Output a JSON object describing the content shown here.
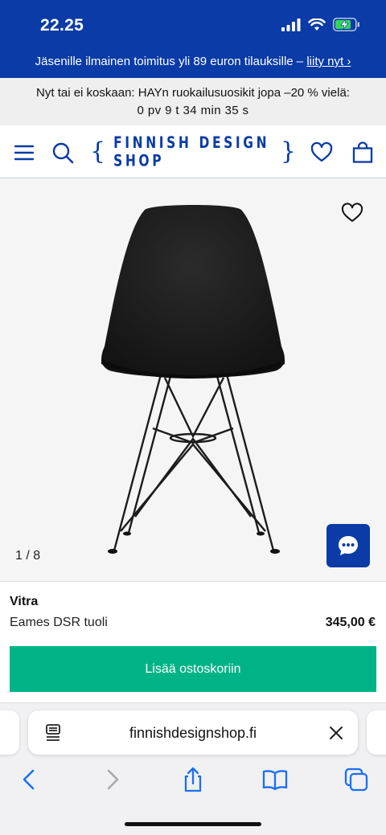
{
  "status_bar": {
    "time": "22.25"
  },
  "promo": {
    "text": "Jäsenille ilmainen toimitus yli 89 euron tilauksille – ",
    "link": "liity nyt ›"
  },
  "countdown": {
    "line1": "Nyt tai ei koskaan: HAYn ruokailusuosikit jopa –20 % vielä:",
    "line2": "0 pv  9 t  34 min  35 s"
  },
  "header": {
    "logo_open": "{",
    "logo_text": "FINNISH DESIGN SHOP",
    "logo_close": "}"
  },
  "gallery": {
    "counter": "1 / 8"
  },
  "product": {
    "brand": "Vitra",
    "name": "Eames DSR tuoli",
    "price": "345,00 €",
    "add_to_cart": "Lisää ostoskoriin"
  },
  "browser": {
    "url": "finnishdesignshop.fi"
  },
  "colors": {
    "brand_blue": "#0a3ba6",
    "cta_green": "#00b386"
  },
  "icons": [
    "menu-icon",
    "search-icon",
    "heart-icon",
    "bag-icon",
    "chat-icon",
    "back-icon",
    "forward-icon",
    "share-icon",
    "bookmarks-icon",
    "tabs-icon"
  ]
}
